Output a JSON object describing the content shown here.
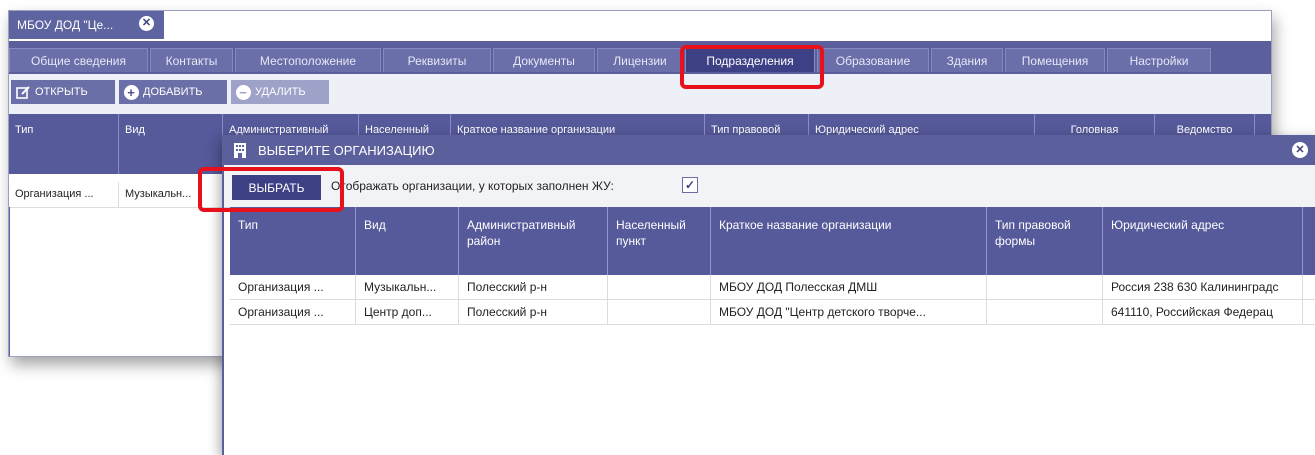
{
  "window": {
    "doc_tab": "МБОУ ДОД \"Це..."
  },
  "tabs": [
    {
      "label": "Общие сведения"
    },
    {
      "label": "Контакты"
    },
    {
      "label": "Местоположение"
    },
    {
      "label": "Реквизиты"
    },
    {
      "label": "Документы"
    },
    {
      "label": "Лицензии"
    },
    {
      "label": "Подразделения",
      "active": true
    },
    {
      "label": "Образование"
    },
    {
      "label": "Здания"
    },
    {
      "label": "Помещения"
    },
    {
      "label": "Настройки"
    }
  ],
  "toolbar": {
    "open_label": "ОТКРЫТЬ",
    "add_label": "ДОБАВИТЬ",
    "delete_label": "УДАЛИТЬ"
  },
  "table": {
    "columns": [
      "Тип",
      "Вид",
      "Административный",
      "Населенный",
      "Краткое название организации",
      "Тип правовой",
      "Юридический адрес",
      "Головная",
      "Ведомство"
    ],
    "rows": [
      [
        "Организация ...",
        "Музыкальн..."
      ]
    ]
  },
  "dialog": {
    "title": "ВЫБЕРИТЕ ОРГАНИЗАЦИЮ",
    "select_label": "ВЫБРАТЬ",
    "filter_label": "Отображать организации, у которых заполнен ЖУ:",
    "filter_checked": "✓",
    "columns": [
      "Тип",
      "Вид",
      "Административный район",
      "Населенный пункт",
      "Краткое название организации",
      "Тип правовой формы",
      "Юридический адрес"
    ],
    "rows": [
      [
        "Организация ...",
        "Музыкальн...",
        "Полесский р-н",
        "",
        "МБОУ ДОД Полесская ДМШ",
        "",
        "Россия 238 630 Калининградс"
      ],
      [
        "Организация ...",
        "Центр доп...",
        "Полесский р-н",
        "",
        "МБОУ ДОД \"Центр детского творче...",
        "",
        "641110, Российская Федерац"
      ]
    ]
  },
  "colors": {
    "header": "#56599a",
    "tab_active": "#3d4084",
    "highlight": "#e8101a"
  }
}
